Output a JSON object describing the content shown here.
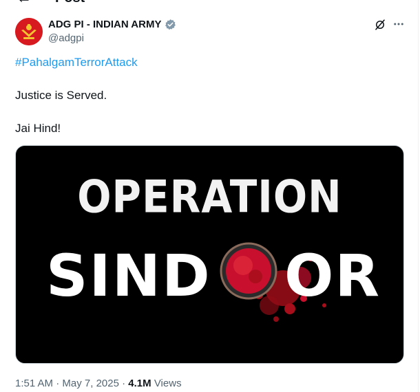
{
  "header": {
    "title": "Post"
  },
  "author": {
    "display_name": "ADG PI - INDIAN ARMY",
    "handle": "@adgpi",
    "verified_color": "#829aab"
  },
  "tweet": {
    "hashtag": "#PahalgamTerrorAttack",
    "line1": "Justice is Served.",
    "line2": "Jai Hind!"
  },
  "media": {
    "line_top": "OPERATION",
    "word_left": "SIND",
    "word_right": "OR"
  },
  "meta": {
    "time": "1:51 AM",
    "separator": " · ",
    "date": "May 7, 2025",
    "views_count": "4.1M",
    "views_label": "Views"
  },
  "colors": {
    "link": "#1d9bf0",
    "secondary": "#536471",
    "avatar_bg": "#d71920",
    "sindoor_red": "#c8102e"
  },
  "icons": [
    "back-arrow-icon",
    "verified-badge-icon",
    "grok-icon",
    "more-icon"
  ]
}
